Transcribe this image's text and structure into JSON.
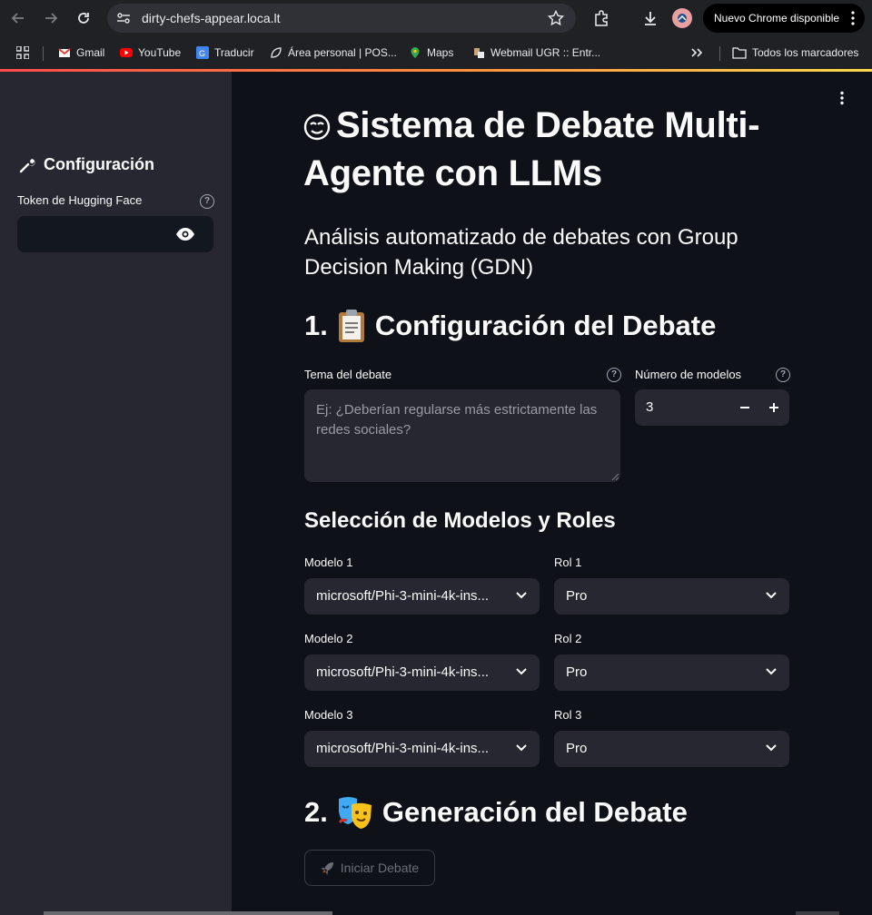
{
  "browser": {
    "url": "dirty-chefs-appear.loca.lt",
    "update_label": "Nuevo Chrome disponible",
    "bookmarks": [
      "Gmail",
      "YouTube",
      "Traducir",
      "Área personal | POS...",
      "Maps",
      "Webmail UGR :: Entr..."
    ],
    "all_bookmarks": "Todos los marcadores"
  },
  "sidebar": {
    "title": "Configuración",
    "token_label": "Token de Hugging Face",
    "token_value": ""
  },
  "main": {
    "title": "Sistema de Debate Multi-Agente con LLMs",
    "subtitle": "Análisis automatizado de debates con Group Decision Making (GDN)",
    "section1": "1. 📋 Configuración del Debate",
    "section1_num": "1.",
    "section1_text": "Configuración del Debate",
    "topic_label": "Tema del debate",
    "topic_placeholder": "Ej: ¿Deberían regularse más estrictamente las redes sociales?",
    "num_models_label": "Número de modelos",
    "num_models_value": "3",
    "models_heading": "Selección de Modelos y Roles",
    "rows": [
      {
        "model_label": "Modelo 1",
        "model_value": "microsoft/Phi-3-mini-4k-ins...",
        "role_label": "Rol 1",
        "role_value": "Pro"
      },
      {
        "model_label": "Modelo 2",
        "model_value": "microsoft/Phi-3-mini-4k-ins...",
        "role_label": "Rol 2",
        "role_value": "Pro"
      },
      {
        "model_label": "Modelo 3",
        "model_value": "microsoft/Phi-3-mini-4k-ins...",
        "role_label": "Rol 3",
        "role_value": "Pro"
      }
    ],
    "section2_num": "2.",
    "section2_text": "Generación del Debate",
    "start_button": "Iniciar Debate"
  },
  "colors": {
    "sidebar_bg": "#262730",
    "main_bg": "#0e1117",
    "input_bg": "#262730",
    "accent_gradient": [
      "#ff4b4b",
      "#ffd84b"
    ]
  }
}
